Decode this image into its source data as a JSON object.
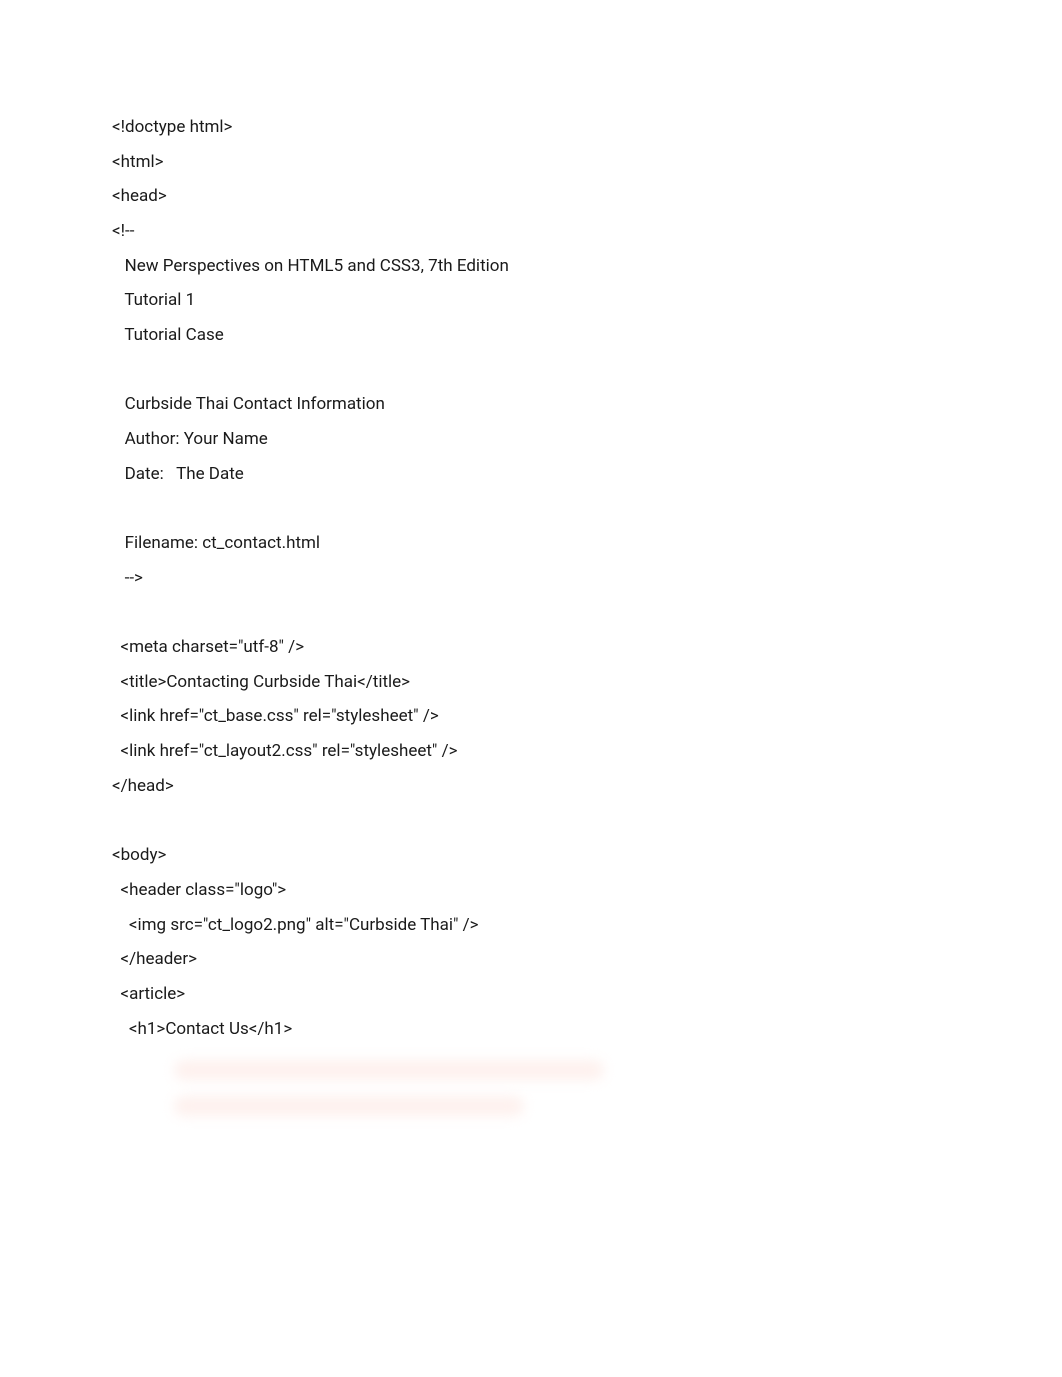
{
  "lines": [
    "<!doctype html>",
    "<html>",
    "<head>",
    "<!--",
    "   New Perspectives on HTML5 and CSS3, 7th Edition",
    "   Tutorial 1",
    "   Tutorial Case",
    "",
    "   Curbside Thai Contact Information",
    "   Author: Your Name",
    "   Date:   The Date",
    "",
    "   Filename: ct_contact.html",
    "   -->",
    "",
    "  <meta charset=\"utf-8\" />",
    "  <title>Contacting Curbside Thai</title>",
    "  <link href=\"ct_base.css\" rel=\"stylesheet\" />",
    "  <link href=\"ct_layout2.css\" rel=\"stylesheet\" />",
    "</head>",
    "",
    "<body>",
    "  <header class=\"logo\">",
    "    <img src=\"ct_logo2.png\" alt=\"Curbside Thai\" />",
    "  </header>",
    "  <article>",
    "    <h1>Contact Us</h1>"
  ]
}
